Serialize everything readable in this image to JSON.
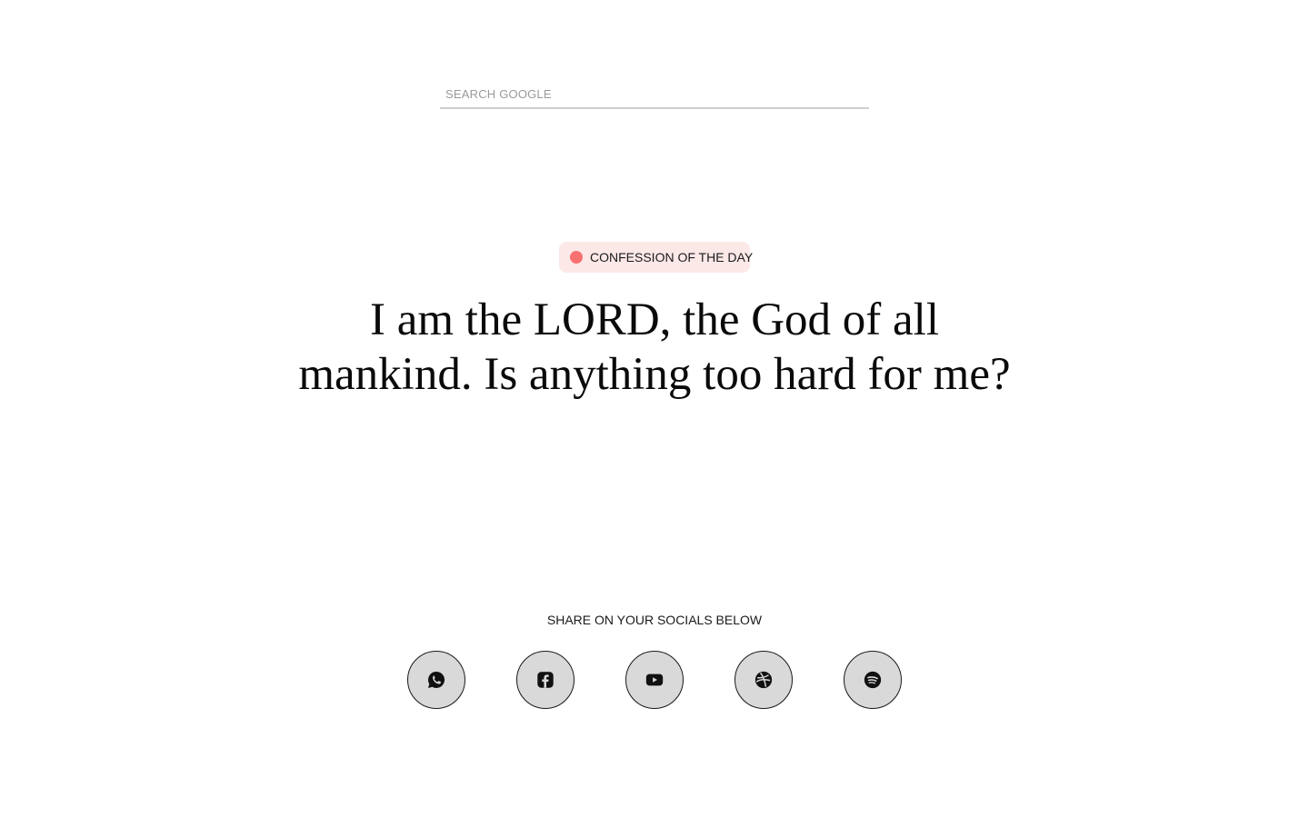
{
  "search": {
    "placeholder": "SEARCH GOOGLE"
  },
  "badge": {
    "label": "CONFESSION OF THE DAY",
    "dot_color": "#f87171",
    "background": "#fde8e8"
  },
  "confession": {
    "text": "I am the LORD, the God of all mankind. Is anything too hard for me?"
  },
  "share": {
    "label": "SHARE ON YOUR SOCIALS BELOW",
    "buttons": [
      {
        "icon": "whatsapp-icon"
      },
      {
        "icon": "facebook-icon"
      },
      {
        "icon": "youtube-icon"
      },
      {
        "icon": "dribbble-icon"
      },
      {
        "icon": "spotify-icon"
      }
    ]
  }
}
